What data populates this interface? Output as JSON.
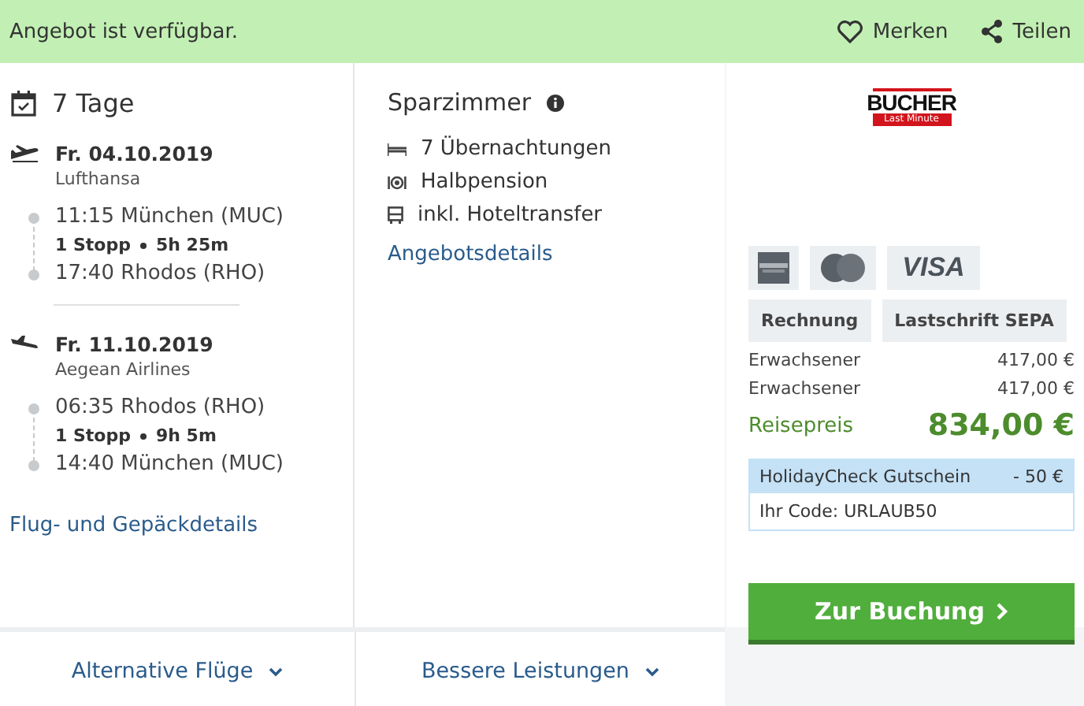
{
  "banner": {
    "message": "Angebot ist verfügbar.",
    "actions": [
      {
        "kind": "heart",
        "label": "Merken"
      },
      {
        "kind": "share",
        "label": "Teilen"
      }
    ]
  },
  "trip": {
    "duration": "7 Tage",
    "flights": [
      {
        "kind": "outbound",
        "date": "Fr. 04.10.2019",
        "airline": "Lufthansa",
        "departure": "11:15 München (MUC)",
        "stops": "1 Stopp",
        "duration": "5h 25m",
        "arrival": "17:40 Rhodos (RHO)"
      },
      {
        "kind": "return",
        "date": "Fr. 11.10.2019",
        "airline": "Aegean Airlines",
        "departure": "06:35 Rhodos (RHO)",
        "stops": "1 Stopp",
        "duration": "9h 5m",
        "arrival": "14:40 München (MUC)"
      }
    ],
    "details_link": "Flug- und Gepäckdetails"
  },
  "room": {
    "title": "Sparzimmer",
    "features": [
      {
        "kind": "bed",
        "label": "7 Übernachtungen"
      },
      {
        "kind": "meal",
        "label": "Halbpension"
      },
      {
        "kind": "bus",
        "label": "inkl. Hoteltransfer"
      }
    ],
    "details_link": "Angebotsdetails"
  },
  "offer": {
    "logo": {
      "name": "BUCHER",
      "tagline": "Last Minute"
    },
    "payment_cards": [
      {
        "kind": "amex"
      },
      {
        "kind": "mastercard"
      },
      {
        "kind": "visa",
        "label": "VISA"
      }
    ],
    "payment_methods": [
      "Rechnung",
      "Lastschrift SEPA"
    ],
    "prices": [
      {
        "label": "Erwachsener",
        "amount": "417,00 €"
      },
      {
        "label": "Erwachsener",
        "amount": "417,00 €"
      }
    ],
    "total": {
      "label": "Reisepreis",
      "amount": "834,00 €"
    },
    "voucher": {
      "title": "HolidayCheck Gutschein",
      "discount": "- 50 €",
      "code": "Ihr Code: URLAUB50"
    },
    "book_button": "Zur Buchung"
  },
  "footer": [
    {
      "label": "Alternative Flüge"
    },
    {
      "label": "Bessere Leistungen"
    }
  ]
}
